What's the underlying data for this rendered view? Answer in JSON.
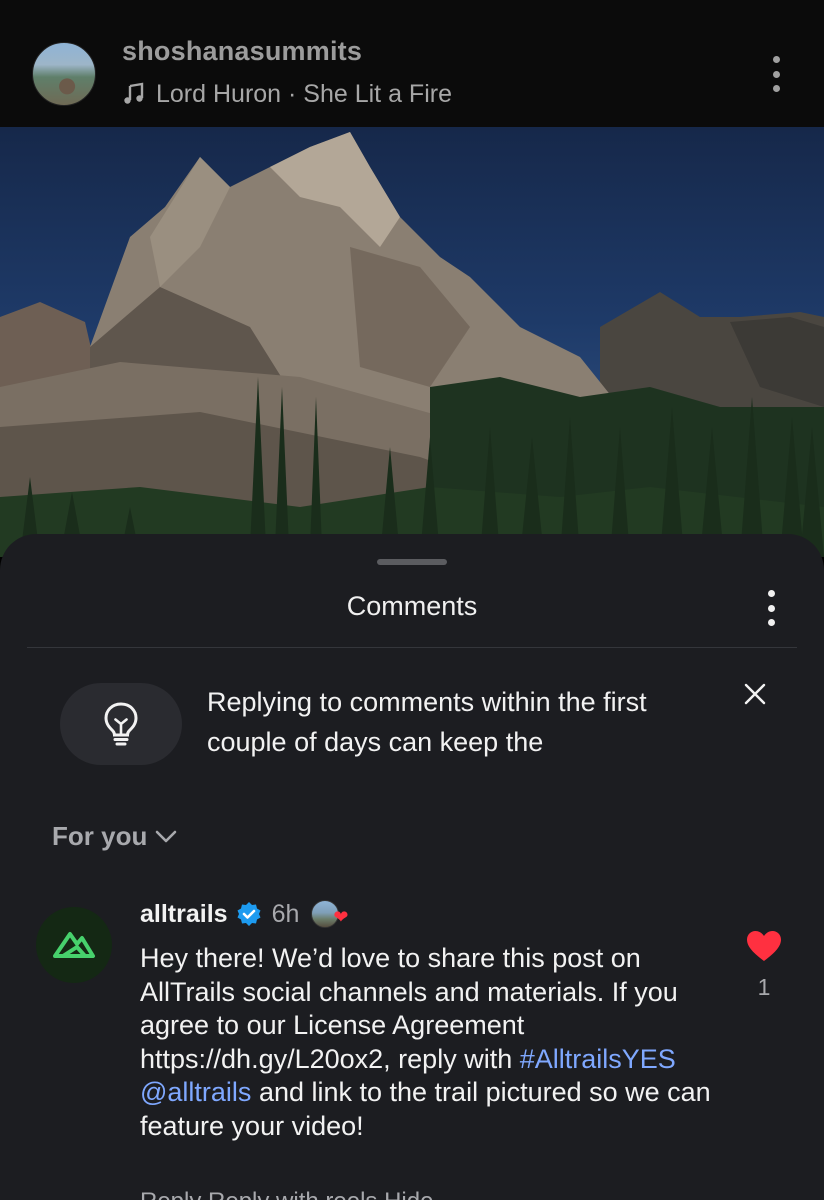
{
  "header": {
    "username": "shoshanasummits",
    "music_icon": "music-note-icon",
    "song": "Lord Huron · She Lit a Fire",
    "more_icon": "more-vertical-icon"
  },
  "photo": {
    "description_icon": "mountain-photo"
  },
  "comments_sheet": {
    "title": "Comments",
    "more_icon": "more-vertical-icon",
    "tip": {
      "icon": "lightbulb-icon",
      "text": "Replying to comments within the first couple of days can keep the",
      "close_icon": "close-icon"
    },
    "sort": {
      "label": "For you",
      "icon": "chevron-down-icon"
    },
    "comments": [
      {
        "username": "alltrails",
        "verified": true,
        "time": "6h",
        "body_parts": {
          "text1": "Hey there! We’d love to share this post on AllTrails social channels and materials. If you agree to our License Agreement https://dh.gy/L20ox2, reply with ",
          "hashtag": "#AlltrailsYES",
          "mention": "@alltrails",
          "text2": " and link to the trail pictured so we can feature your video!"
        },
        "likes": "1",
        "reply_row": "Reply    Reply with reels    Hide"
      }
    ]
  },
  "colors": {
    "sheet_bg": "#1c1d21",
    "accent_link": "#7fa8ff",
    "heart": "#ff3040",
    "verified": "#1d9bf0",
    "alltrails_green": "#47d16c"
  }
}
